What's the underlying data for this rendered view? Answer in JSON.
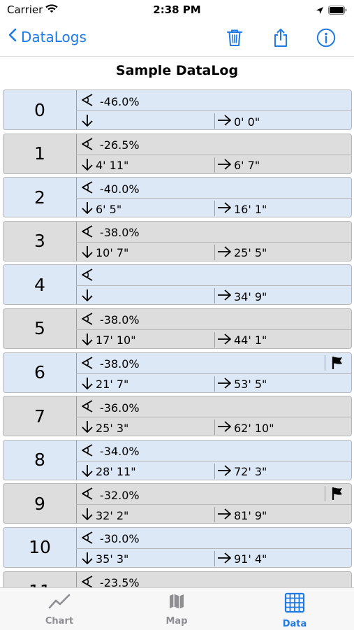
{
  "status": {
    "carrier": "Carrier",
    "time": "2:38 PM"
  },
  "nav": {
    "back_label": "DataLogs",
    "icons": [
      "trash-icon",
      "share-icon",
      "info-icon"
    ]
  },
  "title": "Sample DataLog",
  "rows": [
    {
      "index": "0",
      "angle": "-46.0%",
      "down": "",
      "right": "0' 0\"",
      "flag": false,
      "tone": "blue"
    },
    {
      "index": "1",
      "angle": "-26.5%",
      "down": "4' 11\"",
      "right": "6' 7\"",
      "flag": false,
      "tone": "gray"
    },
    {
      "index": "2",
      "angle": "-40.0%",
      "down": "6' 5\"",
      "right": "16' 1\"",
      "flag": false,
      "tone": "blue"
    },
    {
      "index": "3",
      "angle": "-38.0%",
      "down": "10' 7\"",
      "right": "25' 5\"",
      "flag": false,
      "tone": "gray"
    },
    {
      "index": "4",
      "angle": "",
      "down": "",
      "right": "34' 9\"",
      "flag": false,
      "tone": "blue"
    },
    {
      "index": "5",
      "angle": "-38.0%",
      "down": "17' 10\"",
      "right": "44' 1\"",
      "flag": false,
      "tone": "gray"
    },
    {
      "index": "6",
      "angle": "-38.0%",
      "down": "21' 7\"",
      "right": "53' 5\"",
      "flag": true,
      "tone": "blue"
    },
    {
      "index": "7",
      "angle": "-36.0%",
      "down": "25' 3\"",
      "right": "62' 10\"",
      "flag": false,
      "tone": "gray"
    },
    {
      "index": "8",
      "angle": "-34.0%",
      "down": "28' 11\"",
      "right": "72' 3\"",
      "flag": false,
      "tone": "blue"
    },
    {
      "index": "9",
      "angle": "-32.0%",
      "down": "32' 2\"",
      "right": "81' 9\"",
      "flag": true,
      "tone": "gray"
    },
    {
      "index": "10",
      "angle": "-30.0%",
      "down": "35' 3\"",
      "right": "91' 4\"",
      "flag": false,
      "tone": "blue"
    },
    {
      "index": "11",
      "angle": "-23.5%",
      "down": "",
      "right": "",
      "flag": false,
      "tone": "gray"
    }
  ],
  "tabs": [
    {
      "label": "Chart",
      "icon": "line-chart-icon",
      "active": false
    },
    {
      "label": "Map",
      "icon": "map-icon",
      "active": false
    },
    {
      "label": "Data",
      "icon": "grid-table-icon",
      "active": true
    }
  ],
  "colors": {
    "accent": "#1f7ae6",
    "row_blue": "#dde8f7",
    "row_gray": "#dddddd",
    "tab_inactive": "#8e8e93"
  }
}
